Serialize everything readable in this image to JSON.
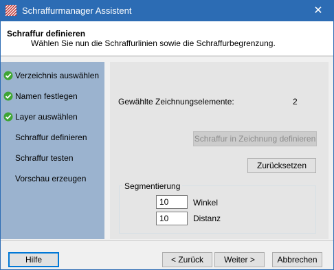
{
  "window": {
    "title": "Schraffurmanager Assistent",
    "close_glyph": "✕",
    "app_icon": "hatch-manager-icon"
  },
  "header": {
    "title": "Schraffur definieren",
    "subtitle": "Wählen Sie nun die Schraffurlinien sowie die Schraffurbegrenzung."
  },
  "sidebar": {
    "items": [
      {
        "label": "Verzeichnis auswählen",
        "done": true
      },
      {
        "label": "Namen festlegen",
        "done": true
      },
      {
        "label": "Layer auswählen",
        "done": true
      },
      {
        "label": "Schraffur definieren",
        "done": false
      },
      {
        "label": "Schraffur testen",
        "done": false
      },
      {
        "label": "Vorschau erzeugen",
        "done": false
      }
    ],
    "check_icon": "check-circle-icon"
  },
  "main": {
    "selected_label": "Gewählte Zeichnungselemente:",
    "selected_value": "2",
    "define_button": "Schraffur in Zeichnung definieren",
    "reset_button": "Zurücksetzen",
    "segment_group": {
      "title": "Segmentierung",
      "angle_value": "10",
      "angle_label": "Winkel",
      "distance_value": "10",
      "distance_label": "Distanz"
    }
  },
  "footer": {
    "help_button": "Hilfe",
    "back_button": "< Zurück",
    "next_button": "Weiter >",
    "cancel_button": "Abbrechen"
  },
  "colors": {
    "titlebar": "#2c6cb4",
    "sidebar": "#9bb3cf",
    "check_green": "#3fa535"
  }
}
